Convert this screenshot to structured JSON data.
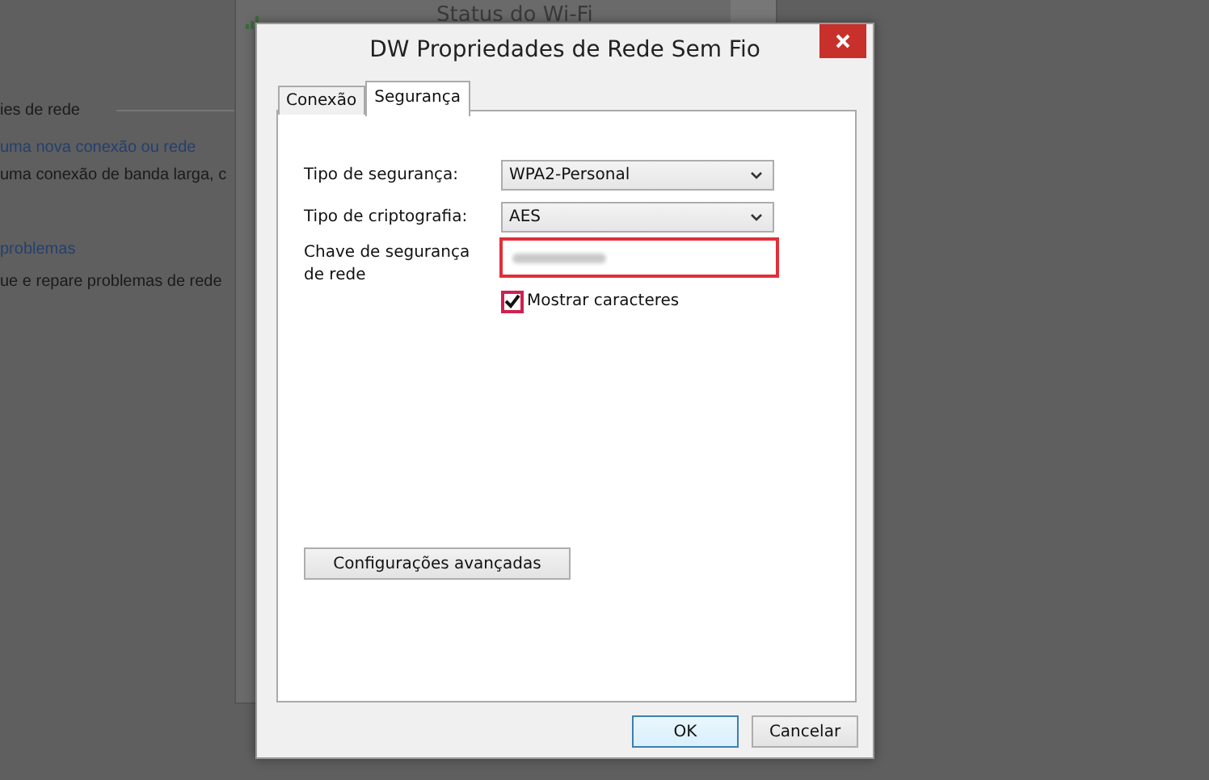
{
  "background": {
    "texts": [
      {
        "kind": "heading",
        "text": "ies de rede"
      },
      {
        "kind": "link",
        "text": "uma nova conexão ou rede"
      },
      {
        "kind": "plain",
        "text": "uma conexão de banda larga, c"
      },
      {
        "kind": "link",
        "text": "problemas"
      },
      {
        "kind": "plain",
        "text": "ue e repare problemas de rede"
      }
    ],
    "back_window": {
      "title": "Status do Wi-Fi"
    }
  },
  "dialog": {
    "title": "DW Propriedades de Rede Sem Fio",
    "tabs": [
      {
        "label": "Conexão",
        "selected": false
      },
      {
        "label": "Segurança",
        "selected": true
      }
    ],
    "security_type": {
      "label": "Tipo de segurança:",
      "value": "WPA2-Personal"
    },
    "encryption_type": {
      "label": "Tipo de criptografia:",
      "value": "AES"
    },
    "security_key": {
      "label": "Chave de segurança de rede",
      "highlighted": true
    },
    "show_characters": {
      "label": "Mostrar caracteres",
      "checked": true,
      "highlighted": true
    },
    "advanced_button": "Configurações avançadas",
    "buttons": [
      {
        "label": "OK",
        "default": true
      },
      {
        "label": "Cancelar",
        "default": false
      }
    ]
  }
}
